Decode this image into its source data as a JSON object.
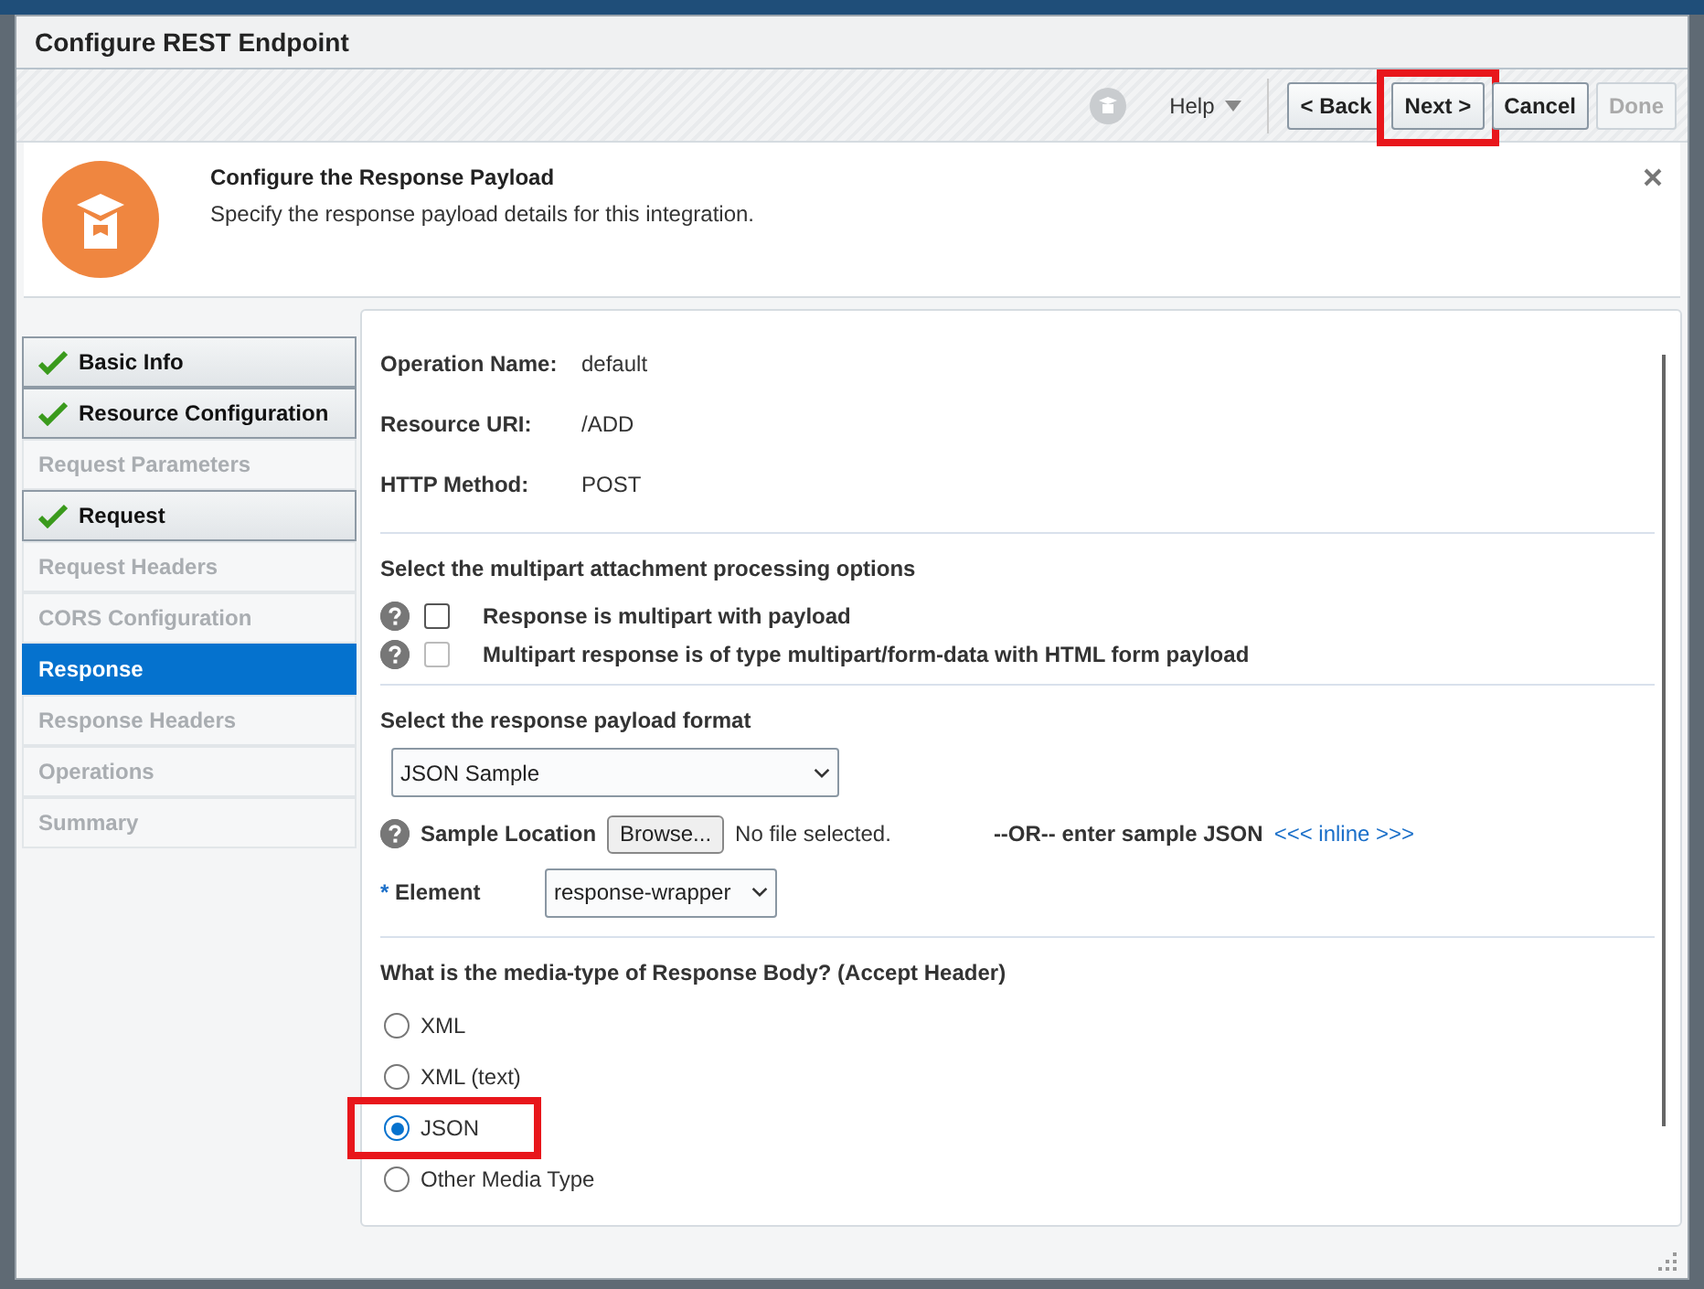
{
  "dialog": {
    "title": "Configure REST Endpoint"
  },
  "toolbar": {
    "help": "Help",
    "buttons": [
      {
        "label": "< Back",
        "disabled": false,
        "highlighted": false
      },
      {
        "label": "Next >",
        "disabled": false,
        "highlighted": true
      },
      {
        "label": "Cancel",
        "disabled": false,
        "highlighted": false
      },
      {
        "label": "Done",
        "disabled": true,
        "highlighted": false
      }
    ]
  },
  "info": {
    "title": "Configure the Response Payload",
    "description": "Specify the response payload details for this integration."
  },
  "nav": [
    {
      "label": "Basic Info",
      "completed": true,
      "disabled": false,
      "selected": false
    },
    {
      "label": "Resource Configuration",
      "completed": true,
      "disabled": false,
      "selected": false
    },
    {
      "label": "Request Parameters",
      "completed": false,
      "disabled": true,
      "selected": false
    },
    {
      "label": "Request",
      "completed": true,
      "disabled": false,
      "selected": false
    },
    {
      "label": "Request Headers",
      "completed": false,
      "disabled": true,
      "selected": false
    },
    {
      "label": "CORS Configuration",
      "completed": false,
      "disabled": true,
      "selected": false
    },
    {
      "label": "Response",
      "completed": false,
      "disabled": false,
      "selected": true
    },
    {
      "label": "Response Headers",
      "completed": false,
      "disabled": true,
      "selected": false
    },
    {
      "label": "Operations",
      "completed": false,
      "disabled": true,
      "selected": false
    },
    {
      "label": "Summary",
      "completed": false,
      "disabled": true,
      "selected": false
    }
  ],
  "details": [
    {
      "label": "Operation Name:",
      "value": "default"
    },
    {
      "label": "Resource URI:",
      "value": "/ADD"
    },
    {
      "label": "HTTP Method:",
      "value": "POST"
    }
  ],
  "multipart": {
    "heading": "Select the multipart attachment processing options",
    "options": [
      {
        "label": "Response is multipart with payload",
        "checked": false,
        "disabled": false
      },
      {
        "label": "Multipart response is of type multipart/form-data with HTML form payload",
        "checked": false,
        "disabled": true
      }
    ]
  },
  "payload": {
    "heading": "Select the response payload format",
    "format": "JSON Sample",
    "sample_label": "Sample Location",
    "browse": "Browse...",
    "file_status": "No file selected.",
    "or_text": "--OR-- enter sample JSON",
    "inline_link": "<<< inline >>>",
    "element_label": "Element",
    "element_required_mark": "*",
    "element_value": "response-wrapper"
  },
  "media": {
    "heading": "What is the media-type of Response Body? (Accept Header)",
    "options": [
      {
        "label": "XML",
        "selected": false,
        "highlighted": false
      },
      {
        "label": "XML (text)",
        "selected": false,
        "highlighted": false
      },
      {
        "label": "JSON",
        "selected": true,
        "highlighted": true
      },
      {
        "label": "Other Media Type",
        "selected": false,
        "highlighted": false
      }
    ]
  }
}
